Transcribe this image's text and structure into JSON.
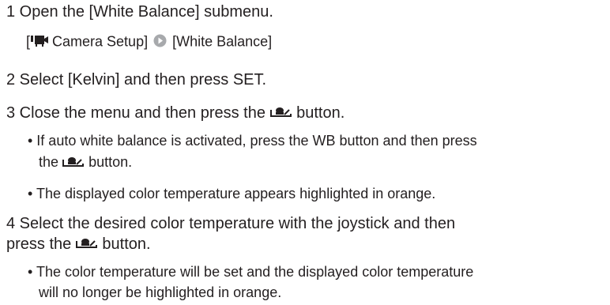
{
  "steps": [
    {
      "title": "1 Open the [White Balance] submenu.",
      "menu_path": {
        "open_bracket": "[",
        "camera_setup": " Camera Setup]",
        "white_balance": " [White Balance]"
      }
    },
    {
      "title": "2 Select [Kelvin] and then press SET."
    },
    {
      "title_prefix": "3 Close the menu and then press the",
      "title_suffix": "button.",
      "bullets": [
        {
          "line1": "• If auto white balance is activated, press the WB button and then press",
          "line2_prefix": "the",
          "line2_suffix": "button."
        },
        {
          "line1": "• The displayed color temperature appears highlighted in orange."
        }
      ]
    },
    {
      "title_line1": "4 Select the desired color temperature with the joystick and then",
      "title_line2_prefix": "press the",
      "title_line2_suffix": "button.",
      "bullets": [
        {
          "line1": "• The color temperature will be set and the displayed color temperature",
          "line2": "will no longer be highlighted in orange."
        }
      ]
    }
  ],
  "icons": [
    "movie-camera-icon",
    "arrow-circle-icon",
    "white-balance-set-icon"
  ]
}
